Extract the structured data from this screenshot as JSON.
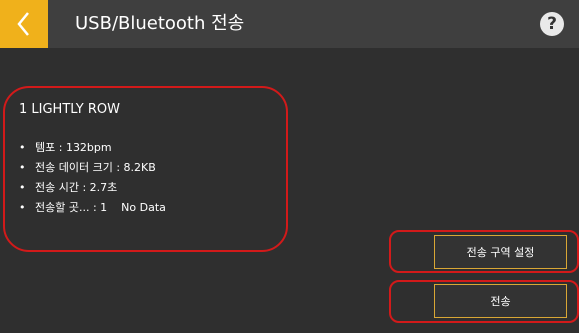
{
  "header": {
    "title": "USB/Bluetooth 전송",
    "back_icon": "chevron-left-icon",
    "help_icon": "question-icon",
    "help_glyph": "?"
  },
  "song": {
    "title": "1 LIGHTLY ROW",
    "details": [
      "템포 : 132bpm",
      "전송 데이터 크기 : 8.2KB",
      "전송 시간 : 2.7초",
      "전송할 곳... : 1    No Data"
    ]
  },
  "buttons": {
    "transfer_range": "전송 구역 설정",
    "transfer": "전송"
  },
  "colors": {
    "accent": "#f0b11b",
    "highlight": "#d21a1a",
    "button_border": "#d9a735"
  }
}
